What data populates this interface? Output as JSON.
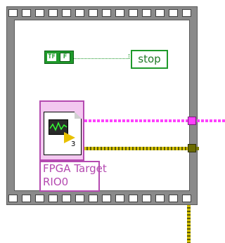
{
  "loop": {
    "frame_color": "#8a8a8a"
  },
  "bool_constant": {
    "tf_glyph": "TF",
    "value": "F",
    "color": "#1f9a2b"
  },
  "stop_terminal": {
    "label": "stop"
  },
  "fpga_vi": {
    "icon_number": "3",
    "label_lines": [
      "FPGA Target",
      "RIO0"
    ],
    "border_color": "#b44ab0"
  },
  "wires": {
    "reference_color": "#ff40ff",
    "error_color": "#d4c000"
  }
}
